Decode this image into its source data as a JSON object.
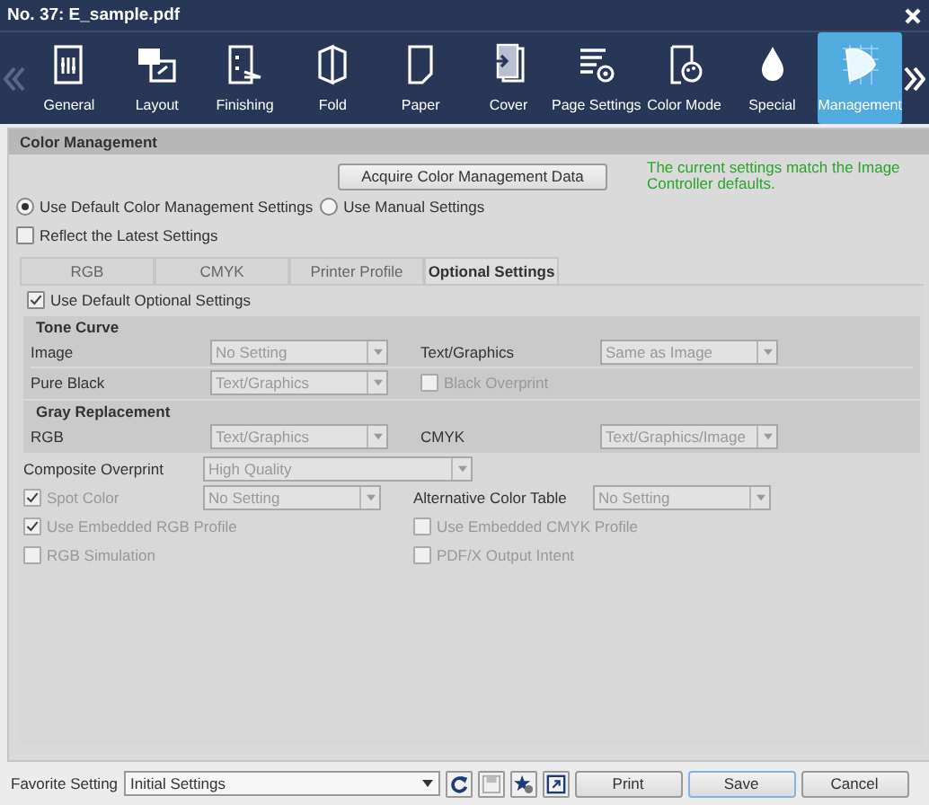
{
  "window": {
    "title": "No. 37: E_sample.pdf"
  },
  "toolbar": {
    "items": [
      {
        "label": "General",
        "selected": false
      },
      {
        "label": "Layout",
        "selected": false
      },
      {
        "label": "Finishing",
        "selected": false
      },
      {
        "label": "Fold",
        "selected": false
      },
      {
        "label": "Paper",
        "selected": false
      },
      {
        "label": "Cover",
        "selected": false
      },
      {
        "label": "Page Settings",
        "selected": false
      },
      {
        "label": "Color Mode",
        "selected": false
      },
      {
        "label": "Special",
        "selected": false
      },
      {
        "label": "Management",
        "selected": true
      }
    ]
  },
  "panel": {
    "title": "Color Management",
    "acquire_button": "Acquire Color Management Data",
    "status_message": "The current settings match the Image Controller defaults.",
    "mode_options": [
      {
        "label": "Use Default Color Management Settings",
        "selected": true
      },
      {
        "label": "Use Manual Settings",
        "selected": false
      }
    ],
    "reflect_latest": {
      "label": "Reflect the Latest Settings",
      "checked": false
    },
    "tabs": [
      {
        "label": "RGB",
        "selected": false
      },
      {
        "label": "CMYK",
        "selected": false
      },
      {
        "label": "Printer Profile",
        "selected": false
      },
      {
        "label": "Optional Settings",
        "selected": true
      }
    ],
    "use_default_optional": {
      "label": "Use Default Optional Settings",
      "checked": true
    },
    "sections": [
      {
        "title": "Tone Curve",
        "shaded": true,
        "rows": [
          [
            {
              "kind": "select",
              "label": "Image",
              "value": "No Setting",
              "disabled": true
            },
            {
              "kind": "select",
              "label": "Text/Graphics",
              "value": "Same as Image",
              "disabled": true
            }
          ],
          [
            {
              "kind": "select",
              "label": "Pure Black",
              "value": "Text/Graphics",
              "disabled": true
            },
            {
              "kind": "checkbox",
              "label": "Black Overprint",
              "checked": false,
              "disabled": true
            }
          ]
        ]
      },
      {
        "title": "Gray Replacement",
        "shaded": true,
        "rows": [
          [
            {
              "kind": "select",
              "label": "RGB",
              "value": "Text/Graphics",
              "disabled": true
            },
            {
              "kind": "select",
              "label": "CMYK",
              "value": "Text/Graphics/Image",
              "disabled": true
            }
          ]
        ]
      },
      {
        "shaded": false,
        "rows": [
          [
            {
              "kind": "wide_select",
              "label": "Composite Overprint",
              "value": "High Quality",
              "disabled": true
            }
          ],
          [
            {
              "kind": "check_select",
              "label": "Spot Color",
              "checked": true,
              "value": "No Setting",
              "disabled": true
            },
            {
              "kind": "select",
              "label": "Alternative Color Table",
              "value": "No Setting",
              "disabled": true
            }
          ],
          [
            {
              "kind": "checkbox",
              "label": "Use Embedded RGB Profile",
              "checked": true,
              "disabled": true
            },
            {
              "kind": "checkbox",
              "label": "Use Embedded CMYK Profile",
              "checked": false,
              "disabled": true
            }
          ],
          [
            {
              "kind": "checkbox",
              "label": "RGB Simulation",
              "checked": false,
              "disabled": true
            },
            {
              "kind": "checkbox",
              "label": "PDF/X Output Intent",
              "checked": false,
              "disabled": true
            }
          ]
        ]
      }
    ]
  },
  "footer": {
    "favorite_label": "Favorite Setting",
    "favorite_value": "Initial Settings",
    "buttons": [
      {
        "label": "Print",
        "default": false
      },
      {
        "label": "Save",
        "default": true
      },
      {
        "label": "Cancel",
        "default": false
      }
    ]
  }
}
